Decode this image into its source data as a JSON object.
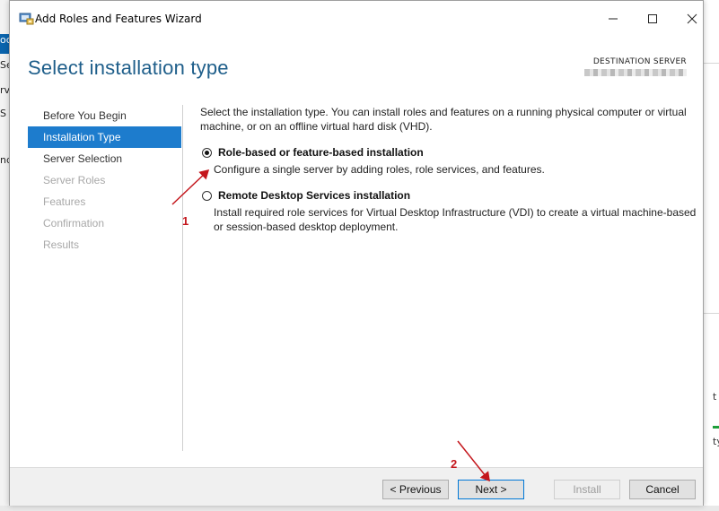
{
  "window": {
    "title": "Add Roles and Features Wizard",
    "icon": "server-manager-icon",
    "controls": {
      "minimize": "—",
      "maximize": "☐",
      "close": "✕"
    }
  },
  "header": {
    "page_title": "Select installation type",
    "destination_label": "DESTINATION SERVER"
  },
  "nav": {
    "items": [
      {
        "label": "Before You Begin",
        "state": "normal"
      },
      {
        "label": "Installation Type",
        "state": "active"
      },
      {
        "label": "Server Selection",
        "state": "normal"
      },
      {
        "label": "Server Roles",
        "state": "disabled"
      },
      {
        "label": "Features",
        "state": "disabled"
      },
      {
        "label": "Confirmation",
        "state": "disabled"
      },
      {
        "label": "Results",
        "state": "disabled"
      }
    ]
  },
  "content": {
    "intro": "Select the installation type. You can install roles and features on a running physical computer or virtual machine, or on an offline virtual hard disk (VHD).",
    "options": [
      {
        "title": "Role-based or feature-based installation",
        "description": "Configure a single server by adding roles, role services, and features.",
        "selected": true
      },
      {
        "title": "Remote Desktop Services installation",
        "description": "Install required role services for Virtual Desktop Infrastructure (VDI) to create a virtual machine-based or session-based desktop deployment.",
        "selected": false
      }
    ]
  },
  "footer": {
    "previous": "< Previous",
    "next": "Next >",
    "install": "Install",
    "cancel": "Cancel"
  },
  "annotations": {
    "step1": "1",
    "step2": "2",
    "color": "#c4161c"
  },
  "background": {
    "left_fragments": [
      "oc",
      "Se",
      "rv",
      "S",
      "nd"
    ],
    "right_fragments": [
      "t",
      "ty"
    ]
  }
}
